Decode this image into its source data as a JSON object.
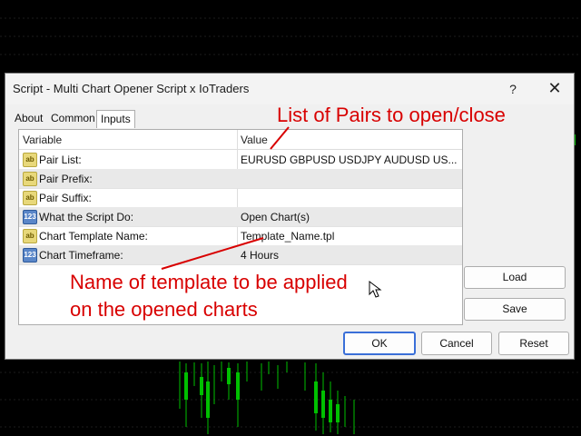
{
  "dialog": {
    "title": "Script - Multi Chart Opener Script x IoTraders",
    "help": "?",
    "close": "✕"
  },
  "tabs": [
    {
      "label": "About"
    },
    {
      "label": "Common"
    },
    {
      "label": "Inputs"
    }
  ],
  "grid": {
    "headers": {
      "variable": "Variable",
      "value": "Value"
    },
    "rows": [
      {
        "icon": "ab",
        "variable": "Pair List:",
        "value": "EURUSD GBPUSD USDJPY AUDUSD US..."
      },
      {
        "icon": "ab",
        "variable": "Pair Prefix:",
        "value": ""
      },
      {
        "icon": "ab",
        "variable": "Pair Suffix:",
        "value": ""
      },
      {
        "icon": "123",
        "variable": "What the Script Do:",
        "value": "Open Chart(s)"
      },
      {
        "icon": "ab",
        "variable": "Chart Template Name:",
        "value": "Template_Name.tpl"
      },
      {
        "icon": "123",
        "variable": "Chart Timeframe:",
        "value": "4 Hours"
      }
    ]
  },
  "side_buttons": {
    "load": "Load",
    "save": "Save"
  },
  "bottom_buttons": {
    "ok": "OK",
    "cancel": "Cancel",
    "reset": "Reset"
  },
  "annotations": {
    "pairs": "List of Pairs to open/close",
    "template_line1": "Name of template to be applied",
    "template_line2": "on the opened charts"
  },
  "colors": {
    "annotation": "#d80000",
    "candles": "#00c000",
    "accent": "#3a6fd8"
  }
}
